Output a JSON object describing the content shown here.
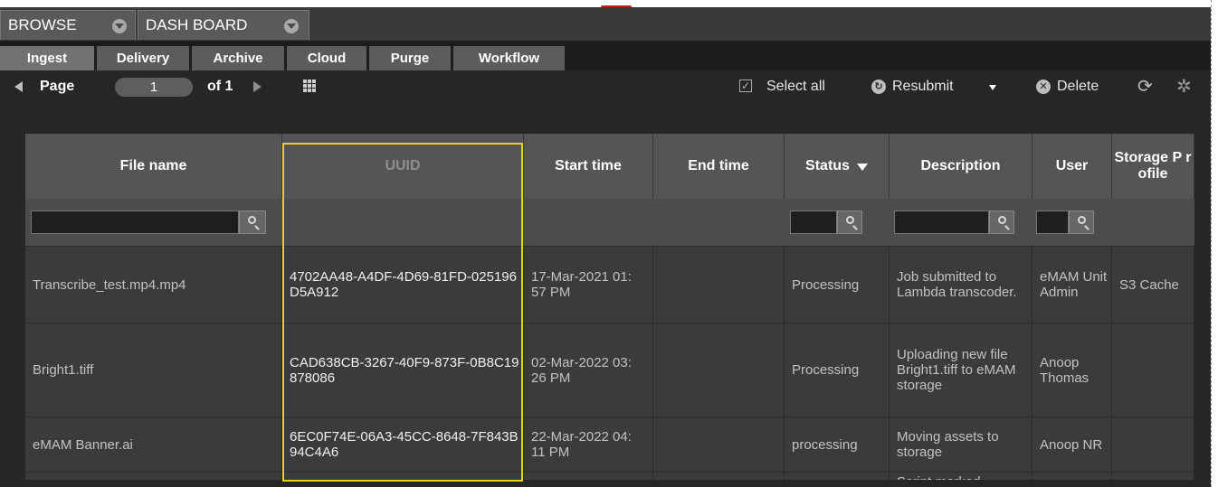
{
  "top_tabs": [
    {
      "label": "BROWSE"
    },
    {
      "label": "DASH BOARD"
    }
  ],
  "sub_tabs": [
    {
      "label": "Ingest"
    },
    {
      "label": "Delivery"
    },
    {
      "label": "Archive"
    },
    {
      "label": "Cloud"
    },
    {
      "label": "Purge"
    },
    {
      "label": "Workflow"
    }
  ],
  "toolbar": {
    "page_label": "Page",
    "page_value": "1",
    "of_label": "of 1",
    "select_all": "Select all",
    "resubmit": "Resubmit",
    "delete": "Delete"
  },
  "table": {
    "headers": {
      "file_name": "File name",
      "uuid": "UUID",
      "start_time": "Start time",
      "end_time": "End time",
      "status": "Status",
      "description": "Description",
      "user": "User",
      "storage_profile": "Storage P rofile"
    },
    "rows": [
      {
        "file_name": "Transcribe_test.mp4.mp4",
        "uuid": "4702AA48-A4DF-4D69-81FD-025196D5A912",
        "start_time": "17-Mar-2021 01:57 PM",
        "end_time": "",
        "status": "Processing",
        "description": "Job submitted to Lambda transcoder.",
        "user": "eMAM Unit Admin",
        "storage_profile": "S3 Cache"
      },
      {
        "file_name": "Bright1.tiff",
        "uuid": "CAD638CB-3267-40F9-873F-0B8C19878086",
        "start_time": "02-Mar-2022 03:26 PM",
        "end_time": "",
        "status": "Processing",
        "description": "Uploading new file Bright1.tiff to eMAM storage",
        "user": "Anoop Thomas",
        "storage_profile": ""
      },
      {
        "file_name": "eMAM Banner.ai",
        "uuid": "6EC0F74E-06A3-45CC-8648-7F843B94C4A6",
        "start_time": "22-Mar-2022 04:11 PM",
        "end_time": "",
        "status": "processing",
        "description": "Moving assets to storage",
        "user": "Anoop NR",
        "storage_profile": ""
      },
      {
        "file_name": "",
        "uuid": "",
        "start_time": "",
        "end_time": "",
        "status": "",
        "description": "Script marked",
        "user": "",
        "storage_profile": ""
      }
    ]
  }
}
